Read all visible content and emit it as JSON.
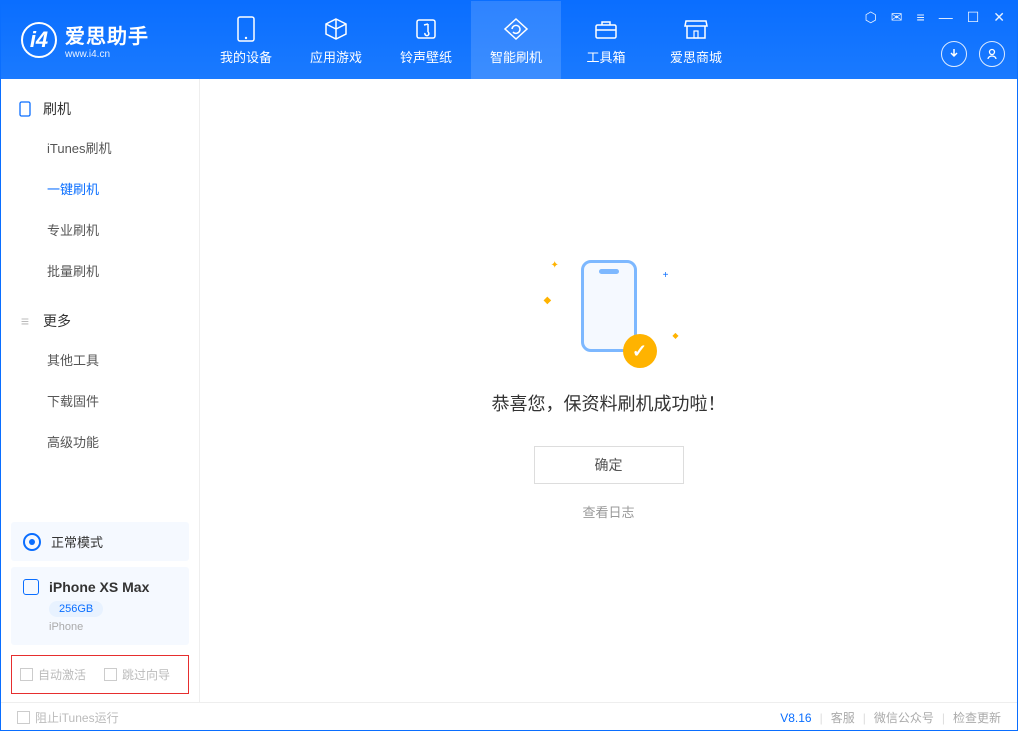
{
  "app": {
    "title": "爱思助手",
    "subtitle": "www.i4.cn",
    "logo_letter": "i4"
  },
  "nav": [
    {
      "label": "我的设备",
      "icon": "device-icon"
    },
    {
      "label": "应用游戏",
      "icon": "cube-icon"
    },
    {
      "label": "铃声壁纸",
      "icon": "music-icon"
    },
    {
      "label": "智能刷机",
      "icon": "refresh-icon",
      "active": true
    },
    {
      "label": "工具箱",
      "icon": "toolbox-icon"
    },
    {
      "label": "爱思商城",
      "icon": "store-icon"
    }
  ],
  "sidebar": {
    "section1": {
      "title": "刷机",
      "items": [
        "iTunes刷机",
        "一键刷机",
        "专业刷机",
        "批量刷机"
      ],
      "active_index": 1
    },
    "section2": {
      "title": "更多",
      "items": [
        "其他工具",
        "下载固件",
        "高级功能"
      ]
    },
    "status": {
      "label": "正常模式"
    },
    "device": {
      "name": "iPhone XS Max",
      "storage": "256GB",
      "type": "iPhone"
    },
    "options": {
      "opt1": "自动激活",
      "opt2": "跳过向导"
    }
  },
  "main": {
    "success_msg": "恭喜您，保资料刷机成功啦！",
    "ok_button": "确定",
    "log_link": "查看日志"
  },
  "footer": {
    "block_itunes": "阻止iTunes运行",
    "version": "V8.16",
    "links": [
      "客服",
      "微信公众号",
      "检查更新"
    ]
  }
}
